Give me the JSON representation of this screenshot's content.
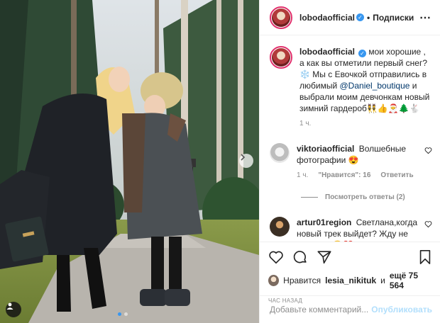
{
  "post": {
    "author": "lobodaofficial",
    "dot": "•",
    "follow_label": "Подписки",
    "more_icon": "⋯",
    "caption": "мои хорошие , а как вы отметили первый снег? ❄️ Мы с Евочкой отправились в любимый",
    "caption_mention": "@Daniel_boutique",
    "caption_end": "и выбрали моим девчонкам новый зимний гардероб👯👍🎅🌲🐇",
    "caption_time": "1 ч."
  },
  "comments": [
    {
      "username": "viktoriaofficial",
      "text": "Волшебные фотографии 😍",
      "time": "1 ч.",
      "likes": "\"Нравится\": 16",
      "reply": "Ответить",
      "avatar_color": "#dcdcdc"
    },
    {
      "username": "artur01region",
      "text": "Светлана,когда новый трек выйдет? Жду не дождусь 😍❤️",
      "avatar_color": "#3b2f24"
    }
  ],
  "replies_label": "Посмотреть ответы (2)",
  "likes": {
    "prefix": "Нравится",
    "user": "lesia_nikituk",
    "and": "и",
    "count": "ещё 75 564"
  },
  "time_label": "ЧАС НАЗАД",
  "add_comment": {
    "placeholder": "Добавьте комментарий...",
    "publish": "Опубликовать"
  },
  "colors": {
    "accent": "#3897f0",
    "mention": "#00376b",
    "muted": "#8e8e8e",
    "publish_disabled": "#b2dffc",
    "story_ring": "#e1306c"
  },
  "icons": [
    "verified-badge-icon",
    "more-options-icon",
    "heart-icon",
    "comment-icon",
    "share-icon",
    "save-icon",
    "user-tag-icon",
    "chevron-right-icon"
  ]
}
